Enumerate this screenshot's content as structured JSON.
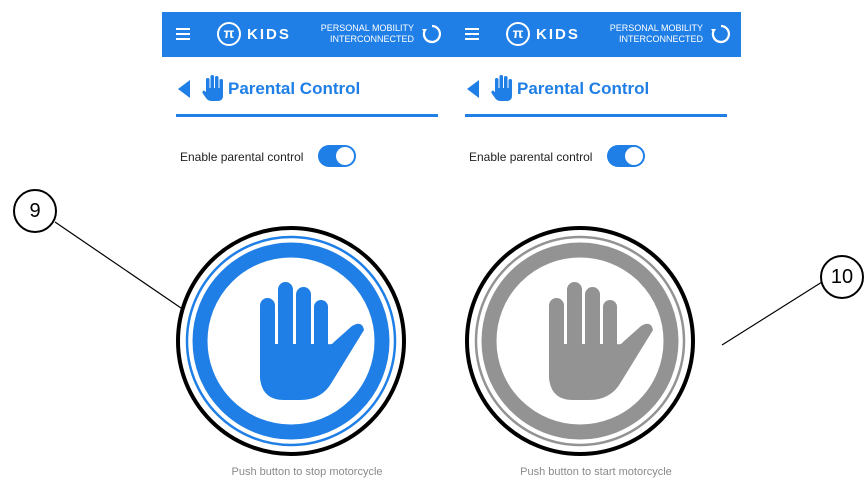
{
  "colors": {
    "accent": "#1f7fe6",
    "inactive": "#939393"
  },
  "brand": {
    "logo_symbol": "π",
    "name": "KIDS",
    "tagline_line1": "PERSONAL MOBILITY",
    "tagline_line2": "INTERCONNECTED"
  },
  "screens": [
    {
      "title": "Parental Control",
      "toggle_label": "Enable parental control",
      "toggle_on": true,
      "button_state": "active",
      "caption": "Push button to stop motorcycle"
    },
    {
      "title": "Parental Control",
      "toggle_label": "Enable parental control",
      "toggle_on": true,
      "button_state": "inactive",
      "caption": "Push button to start motorcycle"
    }
  ],
  "callouts": [
    {
      "label": "9"
    },
    {
      "label": "10"
    }
  ],
  "icons": [
    "menu-icon",
    "refresh-icon",
    "back-arrow-icon",
    "hand-icon",
    "stop-hand-icon"
  ]
}
